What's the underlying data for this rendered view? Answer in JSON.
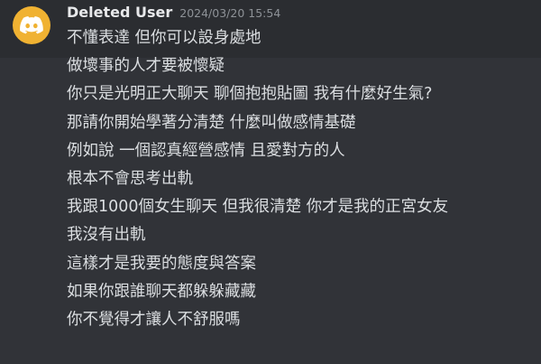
{
  "message": {
    "author": "Deleted User",
    "timestamp": "2024/03/20 15:54",
    "avatar_icon": "discord-logo-icon",
    "avatar_color": "#f0b232",
    "lines": [
      "不懂表達 但你可以設身處地",
      "做壞事的人才要被懷疑",
      "你只是光明正大聊天 聊個抱抱貼圖 我有什麼好生氣?",
      "那請你開始學著分清楚 什麼叫做感情基礎",
      "例如說 一個認真經營感情 且愛對方的人",
      "根本不會思考出軌",
      "我跟1000個女生聊天 但我很清楚 你才是我的正宮女友",
      "我沒有出軌",
      "這樣才是我要的態度與答案",
      "如果你跟誰聊天都躲躲藏藏",
      "你不覺得才讓人不舒服嗎"
    ]
  },
  "colors": {
    "background": "#313338",
    "highlight": "#2b2d31",
    "username": "#e8e9eb",
    "timestamp": "#8e9297",
    "text": "#dbdee1"
  }
}
